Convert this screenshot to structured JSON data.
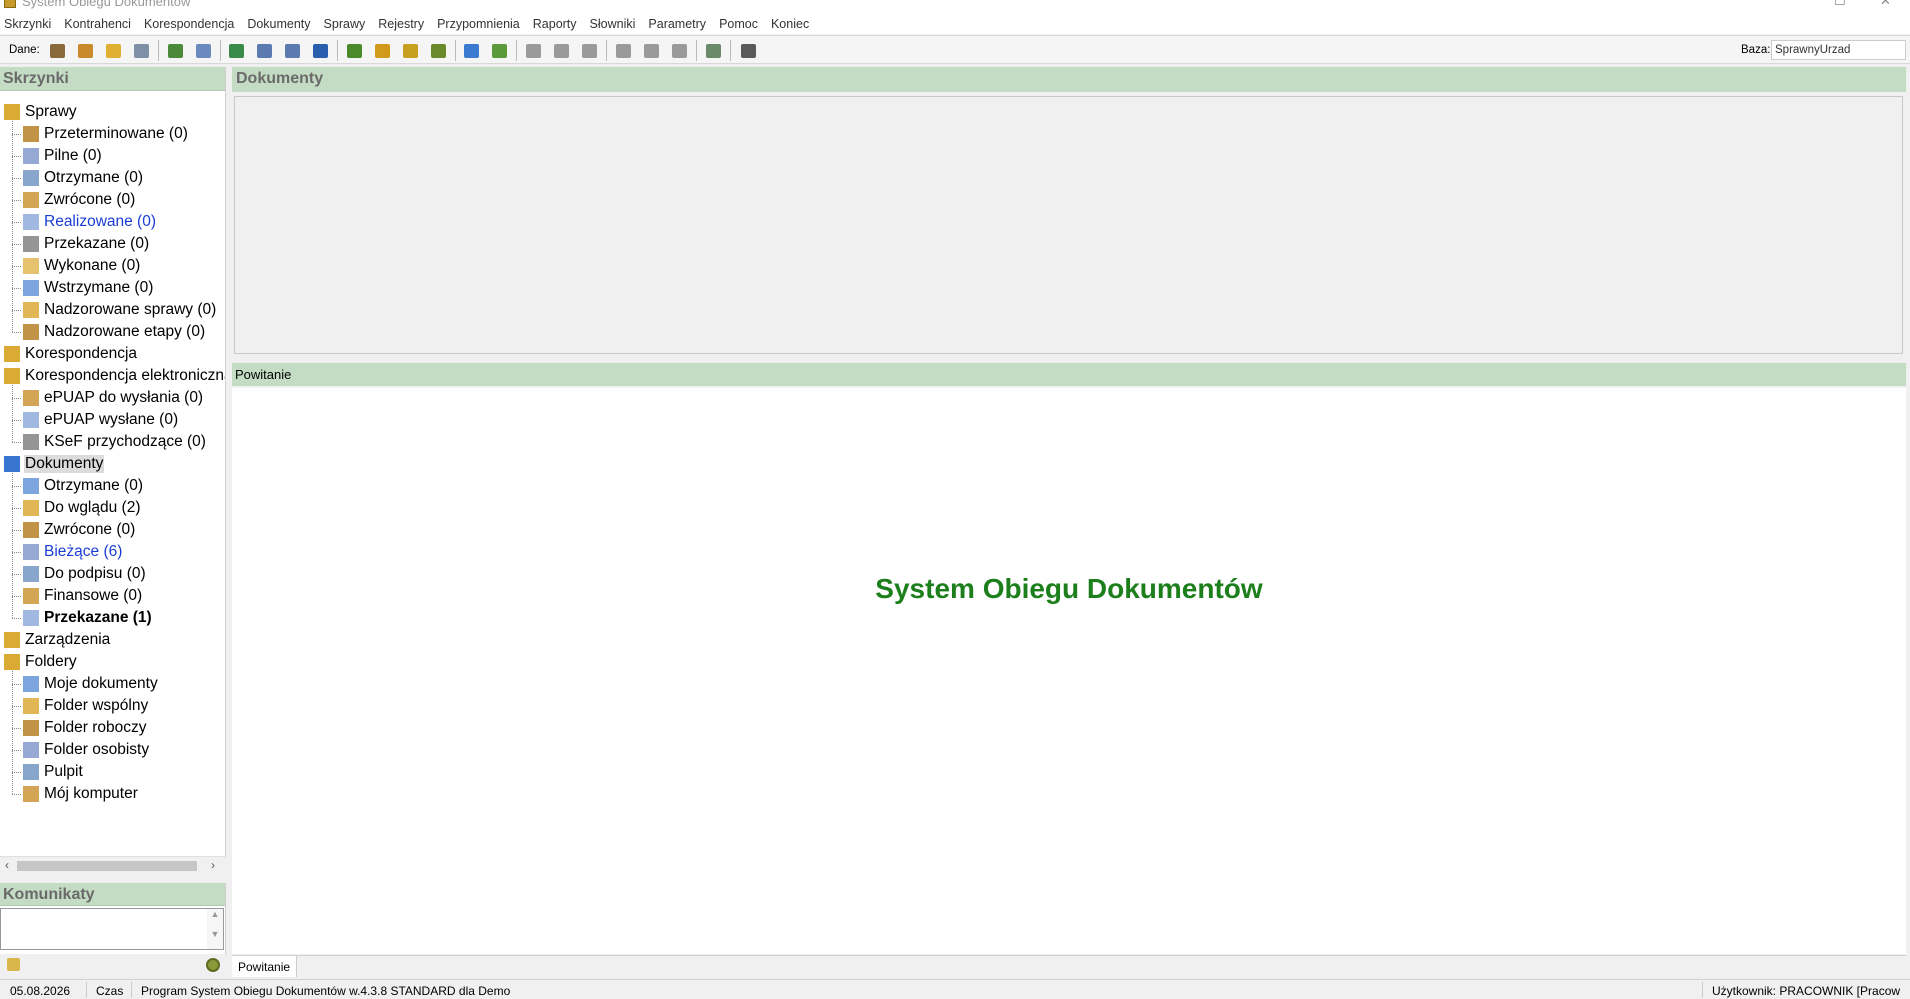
{
  "window": {
    "title": "System Obiegu Dokumentów"
  },
  "menu": [
    "Skrzynki",
    "Kontrahenci",
    "Korespondencja",
    "Dokumenty",
    "Sprawy",
    "Rejestry",
    "Przypomnienia",
    "Raporty",
    "Słowniki",
    "Parametry",
    "Pomoc",
    "Koniec"
  ],
  "toolbar": {
    "dane_label": "Dane:",
    "baza_label": "Baza:",
    "baza_value": "SprawnyUrzad"
  },
  "left": {
    "skrzynki_header": "Skrzynki",
    "tree": [
      {
        "label": "Sprawy",
        "level": 0,
        "style": ""
      },
      {
        "label": "Przeterminowane (0)",
        "level": 1,
        "style": ""
      },
      {
        "label": "Pilne (0)",
        "level": 1,
        "style": ""
      },
      {
        "label": "Otrzymane (0)",
        "level": 1,
        "style": ""
      },
      {
        "label": "Zwrócone (0)",
        "level": 1,
        "style": ""
      },
      {
        "label": "Realizowane (0)",
        "level": 1,
        "style": "blue"
      },
      {
        "label": "Przekazane (0)",
        "level": 1,
        "style": ""
      },
      {
        "label": "Wykonane (0)",
        "level": 1,
        "style": ""
      },
      {
        "label": "Wstrzymane (0)",
        "level": 1,
        "style": ""
      },
      {
        "label": "Nadzorowane sprawy (0)",
        "level": 1,
        "style": ""
      },
      {
        "label": "Nadzorowane etapy (0)",
        "level": 1,
        "style": ""
      },
      {
        "label": "Korespondencja",
        "level": 0,
        "style": ""
      },
      {
        "label": "Korespondencja elektroniczna",
        "level": 0,
        "style": ""
      },
      {
        "label": "ePUAP do wysłania (0)",
        "level": 1,
        "style": ""
      },
      {
        "label": "ePUAP wysłane (0)",
        "level": 1,
        "style": ""
      },
      {
        "label": "KSeF przychodzące (0)",
        "level": 1,
        "style": ""
      },
      {
        "label": "Dokumenty",
        "level": 0,
        "style": "sel"
      },
      {
        "label": "Otrzymane (0)",
        "level": 1,
        "style": ""
      },
      {
        "label": "Do wglądu (2)",
        "level": 1,
        "style": ""
      },
      {
        "label": "Zwrócone (0)",
        "level": 1,
        "style": ""
      },
      {
        "label": "Bieżące (6)",
        "level": 1,
        "style": "blue"
      },
      {
        "label": "Do podpisu (0)",
        "level": 1,
        "style": ""
      },
      {
        "label": "Finansowe (0)",
        "level": 1,
        "style": ""
      },
      {
        "label": "Przekazane (1)",
        "level": 1,
        "style": "bold"
      },
      {
        "label": "Zarządzenia",
        "level": 0,
        "style": ""
      },
      {
        "label": "Foldery",
        "level": 0,
        "style": ""
      },
      {
        "label": "Moje dokumenty",
        "level": 1,
        "style": ""
      },
      {
        "label": "Folder wspólny",
        "level": 1,
        "style": ""
      },
      {
        "label": "Folder roboczy",
        "level": 1,
        "style": ""
      },
      {
        "label": "Folder osobisty",
        "level": 1,
        "style": ""
      },
      {
        "label": "Pulpit",
        "level": 1,
        "style": ""
      },
      {
        "label": "Mój komputer",
        "level": 1,
        "style": ""
      }
    ],
    "komunikaty_header": "Komunikaty"
  },
  "main": {
    "dokumenty_header": "Dokumenty",
    "powitanie_header": "Powitanie",
    "welcome_text": "System Obiegu Dokumentów",
    "tab_label": "Powitanie"
  },
  "status": {
    "date": "05.08.2026",
    "czas": "Czas",
    "program": "Program System Obiegu Dokumentów w.4.3.8 STANDARD dla Demo",
    "user": "Użytkownik: PRACOWNIK [Pracow"
  },
  "colors": {
    "panel_header": "#c5dcc4",
    "welcome_text": "#1c7f1c",
    "link_blue": "#1a3dd6"
  }
}
